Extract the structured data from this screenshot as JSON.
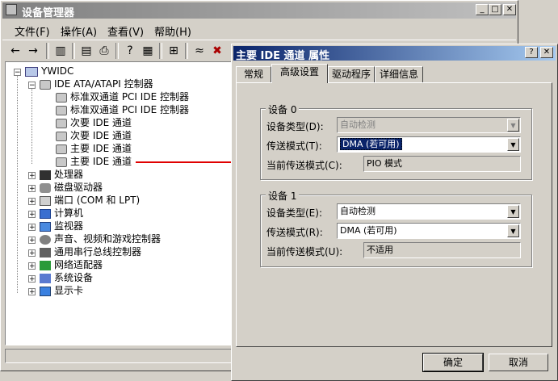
{
  "dm": {
    "title": "设备管理器",
    "menu": [
      "文件(F)",
      "操作(A)",
      "查看(V)",
      "帮助(H)"
    ],
    "tree": {
      "root": "YWIDC",
      "ide": {
        "label": "IDE ATA/ATAPI 控制器",
        "items": [
          "标准双通道 PCI IDE 控制器",
          "标准双通道 PCI IDE 控制器",
          "次要 IDE 通道",
          "次要 IDE 通道",
          "主要 IDE 通道",
          "主要 IDE 通道"
        ]
      },
      "categories": [
        "处理器",
        "磁盘驱动器",
        "端口 (COM 和 LPT)",
        "计算机",
        "监视器",
        "声音、视频和游戏控制器",
        "通用串行总线控制器",
        "网络适配器",
        "系统设备",
        "显示卡"
      ]
    }
  },
  "dialog": {
    "title": "主要 IDE 通道 属性",
    "tabs": [
      "常规",
      "高级设置",
      "驱动程序",
      "详细信息"
    ],
    "device0": {
      "group": "设备 0",
      "type_label": "设备类型(D):",
      "type_value": "自动检测",
      "mode_label": "传送模式(T):",
      "mode_value": "DMA (若可用)",
      "current_label": "当前传送模式(C):",
      "current_value": "PIO 模式"
    },
    "device1": {
      "group": "设备 1",
      "type_label": "设备类型(E):",
      "type_value": "自动检测",
      "mode_label": "传送模式(R):",
      "mode_value": "DMA (若可用)",
      "current_label": "当前传送模式(U):",
      "current_value": "不适用"
    },
    "ok": "确定",
    "cancel": "取消"
  }
}
